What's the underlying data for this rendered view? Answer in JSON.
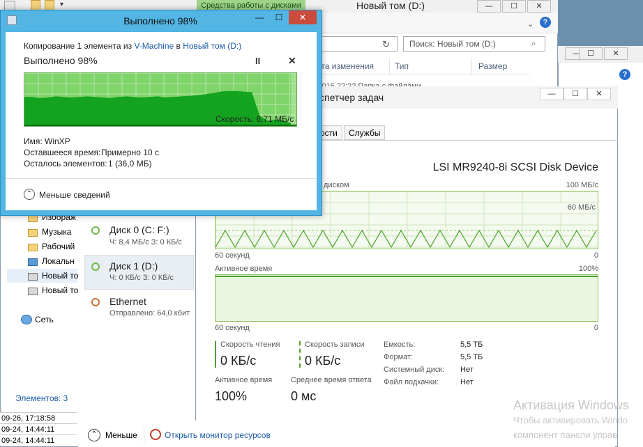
{
  "explorer": {
    "ribbon_tab": "Средства работы с дисками",
    "title": "Новый том (D:)",
    "search_placeholder": "Поиск: Новый том (D:)",
    "columns": [
      "ата изменения",
      "Тип",
      "Размер"
    ],
    "row_partial": "07.2016 22:22      Папка с файлами",
    "nav_items": [
      "Изображ",
      "Музыка",
      "Рабочий",
      "Локальн",
      "Новый то",
      "Новый то"
    ],
    "network": "Сеть",
    "status_count": "Элементов: 3",
    "log_lines": [
      "09-26, 17:18:58",
      "09-24, 14:44:11",
      "09-24, 14:44:11"
    ],
    "help": "?"
  },
  "copy_dialog": {
    "title": "Выполнено 98%",
    "desc_prefix": "Копирование 1 элемента из ",
    "source": "V-Machine",
    "desc_mid": " в ",
    "dest": "Новый том (D:)",
    "progress_title": "Выполнено 98%",
    "pause": "II",
    "close": "✕",
    "speed": "Скорость: 6,71 МБ/с",
    "name_label": "Имя:",
    "name_value": "WinXP",
    "remaining_label": "Оставшееся время:",
    "remaining_value": "Примерно 10 с",
    "items_label": "Осталось элементов:",
    "items_value": "1 (36,0 МБ)",
    "less_details": "Меньше сведений",
    "progress": 0.98,
    "throughput_profile": [
      0.55,
      0.55,
      0.53,
      0.54,
      0.56,
      0.55,
      0.54,
      0.55,
      0.56,
      0.55,
      0.54,
      0.53,
      0.55,
      0.56,
      0.55,
      0.54,
      0.55,
      0.56,
      0.54,
      0.55,
      0.56,
      0.57,
      0.58,
      0.6,
      0.62,
      0.65,
      0.66,
      0.66,
      0.65,
      0.64,
      0.2,
      0.1,
      0.12,
      0.11,
      0.05
    ]
  },
  "task_manager": {
    "title": "спетчер задач",
    "tabs": [
      "ости",
      "Службы"
    ],
    "disk_name": "LSI MR9240-8i SCSI Disk Device",
    "graph1_label": "диском",
    "graph1_max": "100 МБ/с",
    "graph1_mid": "60 МБ/с",
    "graph1_time": "60 секунд",
    "graph1_min": "0",
    "graph2_label": "Активное время",
    "graph2_max": "100%",
    "graph2_time": "60 секунд",
    "graph2_min": "0",
    "read_label": "Скорость чтения",
    "read_value": "0 КБ/с",
    "write_label": "Скорость записи",
    "write_value": "0 КБ/с",
    "active_label": "Активное время",
    "active_value": "100%",
    "resp_label": "Среднее время ответа",
    "resp_value": "0 мс",
    "capacity_label": "Емкость:",
    "capacity_value": "5,5 ТБ",
    "format_label": "Формат:",
    "format_value": "5,5 ТБ",
    "sysdisk_label": "Системный диск:",
    "sysdisk_value": "Нет",
    "pagefile_label": "Файл подкачки:",
    "pagefile_value": "Нет",
    "resources": [
      {
        "title": "Диск 0 (C: F:)",
        "sub": "Ч: 8,4 МБ/с З: 0 КБ/с"
      },
      {
        "title": "Диск 1 (D:)",
        "sub": "Ч: 0 КБ/с З: 0 КБ/с"
      },
      {
        "title": "Ethernet",
        "sub": "Отправлено: 64,0 кбит"
      }
    ],
    "footer_less": "Меньше",
    "footer_monitor": "Открыть монитор ресурсов",
    "accent": "#4ca22c",
    "ethernet_color": "#c8703a"
  },
  "window_buttons": {
    "minimize": "—",
    "maximize": "☐",
    "close": "✕"
  },
  "watermark": {
    "title": "Активация Windows",
    "line1": "Чтобы активировать Windo",
    "line2": "компонент панели управ"
  }
}
